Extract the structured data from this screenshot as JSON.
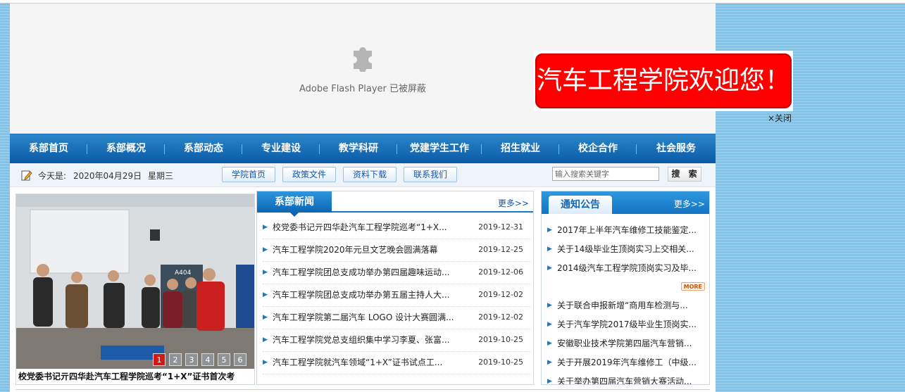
{
  "flash": {
    "message": "Adobe Flash Player 已被屏蔽",
    "icon": "puzzle-piece-icon"
  },
  "nav": {
    "items": [
      "系部首页",
      "系部概况",
      "系部动态",
      "专业建设",
      "教学科研",
      "党建学生工作",
      "招生就业",
      "校企合作",
      "社会服务"
    ]
  },
  "info": {
    "today_label": "今天是:",
    "date": "2020年04月29日",
    "weekday": "星期三"
  },
  "quick_links": [
    "学院首页",
    "政策文件",
    "资料下载",
    "联系我们"
  ],
  "search": {
    "placeholder": "输入搜索关键字",
    "button": "搜 索"
  },
  "slider": {
    "caption": "校党委书记亓四华赴汽车工程学院巡考“1+X”证书首次考",
    "pages": [
      "1",
      "2",
      "3",
      "4",
      "5",
      "6"
    ],
    "active_page": 1,
    "room_sign": "A404"
  },
  "news": {
    "title": "系部新闻",
    "more": "更多>>",
    "items": [
      {
        "title": "校党委书记亓四华赴汽车工程学院巡考“1+X...",
        "date": "2019-12-31"
      },
      {
        "title": "汽车工程学院2020年元旦文艺晚会圆满落幕",
        "date": "2019-12-25"
      },
      {
        "title": "汽车工程学院团总支成功举办第四届趣味运动...",
        "date": "2019-12-06"
      },
      {
        "title": "汽车工程学院团总支成功举办第五届主持人大...",
        "date": "2019-12-02"
      },
      {
        "title": "汽车工程学院第二届汽车 LOGO 设计大赛圆满...",
        "date": "2019-12-02"
      },
      {
        "title": "汽车工程学院党总支组织集中学习李夏、张富...",
        "date": "2019-10-25"
      },
      {
        "title": "汽车工程学院就汽车领域“1+X”证书试点工...",
        "date": "2019-10-25"
      }
    ]
  },
  "notice": {
    "title": "通知公告",
    "more": "更多>>",
    "items_top": [
      "2017年上半年汽车维修工技能鉴定...",
      "关于14级毕业生顶岗实习上交相关...",
      "2014级汽车工程学院顶岗实习及毕..."
    ],
    "more_badge": "MORE",
    "items_bottom": [
      "关于联合申报新增“商用车检测与...",
      "关于汽车学院2017级毕业生顶岗实...",
      "安徽职业技术学院第四届汽车营销...",
      "关于开展2019年汽车维修工（中级...",
      "关于举办第四届汽车营销大赛活动..."
    ]
  },
  "banner": {
    "text": "汽车工程学院欢迎您！",
    "close": "×关闭"
  }
}
